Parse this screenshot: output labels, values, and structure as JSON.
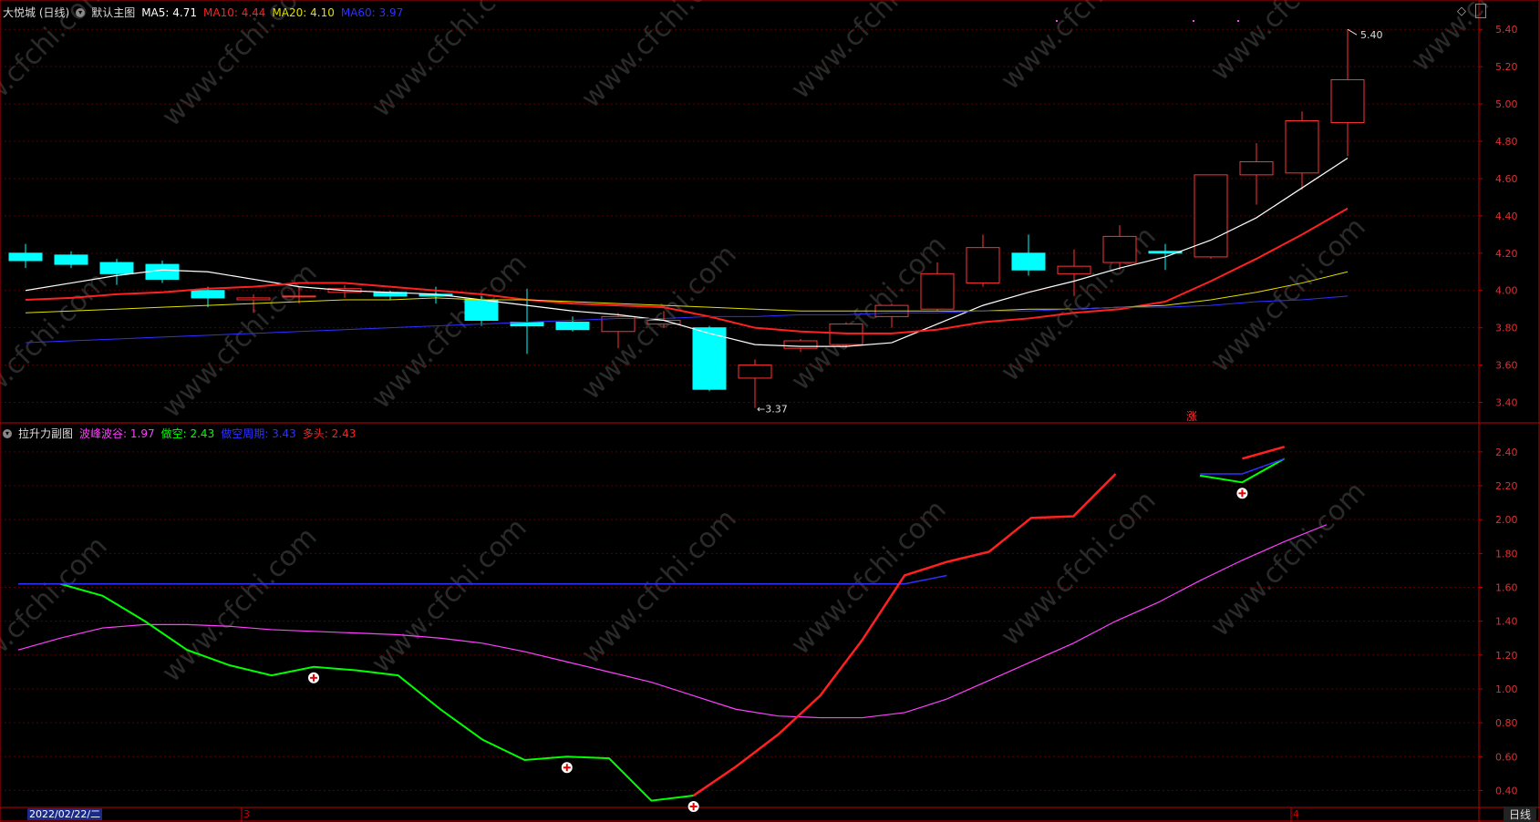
{
  "main_header": {
    "stock": "大悦城 (日线)",
    "template": "默认主图",
    "ma5_label": "MA5:",
    "ma5_val": "4.71",
    "ma10_label": "MA10:",
    "ma10_val": "4.44",
    "ma20_label": "MA20:",
    "ma20_val": "4.10",
    "ma60_label": "MA60:",
    "ma60_val": "3.97"
  },
  "sub_header": {
    "name": "拉升力副图",
    "s1_label": "波峰波谷:",
    "s1_val": "1.97",
    "s2_label": "做空:",
    "s2_val": "2.43",
    "s3_label": "做空周期:",
    "s3_val": "3.43",
    "s4_label": "多头:",
    "s4_val": "2.43"
  },
  "annotations": {
    "high": "5.40",
    "low": "3.37",
    "rise_marker": "涨"
  },
  "bottom": {
    "date": "2022/02/22/二",
    "m3": "3",
    "m4": "4",
    "period": "日线"
  },
  "watermark": "www.cfchi.com",
  "colors": {
    "up": "#ff3333",
    "down": "#00ffff",
    "ma5": "#ffffff",
    "ma10": "#ff2020",
    "ma20": "#e0e000",
    "ma60": "#3030ff",
    "grid": "#5a0000",
    "axis": "#c00000",
    "green": "#00ff00",
    "magenta": "#ff40ff"
  },
  "chart_data": [
    {
      "type": "candlestick",
      "title": "大悦城 (日线)",
      "ylim": [
        3.3,
        5.45
      ],
      "yticks": [
        "3.40",
        "3.60",
        "3.80",
        "4.00",
        "4.20",
        "4.40",
        "4.60",
        "4.80",
        "5.00",
        "5.20",
        "5.40"
      ],
      "candles": [
        [
          4.2,
          4.16,
          4.25,
          4.12
        ],
        [
          4.19,
          4.14,
          4.21,
          4.12
        ],
        [
          4.15,
          4.09,
          4.17,
          4.03
        ],
        [
          4.14,
          4.06,
          4.16,
          4.04
        ],
        [
          4.0,
          3.96,
          4.02,
          3.91
        ],
        [
          3.95,
          3.96,
          3.98,
          3.88
        ],
        [
          3.97,
          3.97,
          4.02,
          3.93
        ],
        [
          3.99,
          4.01,
          4.03,
          3.96
        ],
        [
          3.99,
          3.97,
          4.0,
          3.95
        ],
        [
          3.98,
          3.97,
          4.02,
          3.93
        ],
        [
          3.95,
          3.84,
          3.97,
          3.81
        ],
        [
          3.83,
          3.81,
          4.01,
          3.66
        ],
        [
          3.83,
          3.79,
          3.86,
          3.78
        ],
        [
          3.78,
          3.86,
          3.88,
          3.69
        ],
        [
          3.82,
          3.84,
          3.89,
          3.8
        ],
        [
          3.8,
          3.47,
          3.81,
          3.46
        ],
        [
          3.53,
          3.6,
          3.63,
          3.37
        ],
        [
          3.69,
          3.73,
          3.74,
          3.67
        ],
        [
          3.71,
          3.82,
          3.83,
          3.69
        ],
        [
          3.86,
          3.92,
          3.93,
          3.8
        ],
        [
          3.9,
          4.09,
          4.15,
          3.89
        ],
        [
          4.04,
          4.23,
          4.3,
          4.02
        ],
        [
          4.2,
          4.11,
          4.3,
          4.08
        ],
        [
          4.09,
          4.13,
          4.22,
          3.97
        ],
        [
          4.15,
          4.29,
          4.35,
          4.11
        ],
        [
          4.21,
          4.2,
          4.25,
          4.11
        ],
        [
          4.18,
          4.62,
          4.62,
          4.17
        ],
        [
          4.62,
          4.69,
          4.79,
          4.46
        ],
        [
          4.63,
          4.91,
          4.96,
          4.54
        ],
        [
          4.9,
          5.13,
          5.4,
          4.72
        ]
      ],
      "series": [
        {
          "name": "MA5",
          "values": [
            4.0,
            4.04,
            4.08,
            4.11,
            4.1,
            4.06,
            4.02,
            4.0,
            3.99,
            3.98,
            3.95,
            3.92,
            3.89,
            3.87,
            3.84,
            3.77,
            3.71,
            3.7,
            3.7,
            3.72,
            3.82,
            3.92,
            3.99,
            4.05,
            4.12,
            4.18,
            4.27,
            4.39,
            4.55,
            4.71
          ]
        },
        {
          "name": "MA10",
          "values": [
            3.95,
            3.96,
            3.98,
            3.99,
            4.01,
            4.02,
            4.04,
            4.04,
            4.02,
            4.0,
            3.98,
            3.95,
            3.93,
            3.92,
            3.91,
            3.86,
            3.8,
            3.78,
            3.77,
            3.77,
            3.79,
            3.83,
            3.85,
            3.88,
            3.9,
            3.94,
            4.05,
            4.17,
            4.3,
            4.44
          ]
        },
        {
          "name": "MA20",
          "values": [
            3.88,
            3.89,
            3.9,
            3.91,
            3.92,
            3.93,
            3.94,
            3.95,
            3.95,
            3.96,
            3.95,
            3.95,
            3.94,
            3.93,
            3.92,
            3.91,
            3.9,
            3.89,
            3.89,
            3.89,
            3.89,
            3.89,
            3.9,
            3.9,
            3.91,
            3.92,
            3.95,
            3.99,
            4.04,
            4.1
          ]
        },
        {
          "name": "MA60",
          "values": [
            3.72,
            3.73,
            3.74,
            3.75,
            3.76,
            3.77,
            3.78,
            3.79,
            3.8,
            3.81,
            3.82,
            3.83,
            3.84,
            3.85,
            3.85,
            3.86,
            3.86,
            3.87,
            3.87,
            3.88,
            3.88,
            3.89,
            3.89,
            3.9,
            3.91,
            3.91,
            3.92,
            3.94,
            3.95,
            3.97
          ]
        }
      ]
    },
    {
      "type": "line",
      "title": "拉升力副图",
      "ylim": [
        0.3,
        2.55
      ],
      "yticks": [
        "0.40",
        "0.60",
        "0.80",
        "1.00",
        "1.20",
        "1.40",
        "1.60",
        "1.80",
        "2.00",
        "2.20",
        "2.40"
      ],
      "series": [
        {
          "name": "波峰波谷",
          "values": [
            1.23,
            1.3,
            1.36,
            1.38,
            1.38,
            1.37,
            1.35,
            1.34,
            1.33,
            1.32,
            1.3,
            1.27,
            1.22,
            1.16,
            1.1,
            1.04,
            0.96,
            0.88,
            0.84,
            0.83,
            0.83,
            0.86,
            0.94,
            1.05,
            1.16,
            1.27,
            1.4,
            1.51,
            1.64,
            1.76,
            1.87,
            1.97
          ]
        },
        {
          "name": "做空",
          "values": [
            null,
            1.62,
            1.55,
            1.4,
            1.23,
            1.14,
            1.08,
            1.13,
            1.11,
            1.08,
            0.88,
            0.7,
            0.58,
            0.6,
            0.59,
            0.34,
            0.37,
            null,
            null,
            null,
            null,
            null,
            null,
            null,
            null,
            null,
            null,
            null,
            2.26,
            2.22,
            2.36,
            null
          ]
        },
        {
          "name": "做空周期",
          "values": [
            1.62,
            1.62,
            1.62,
            1.62,
            1.62,
            1.62,
            1.62,
            1.62,
            1.62,
            1.62,
            1.62,
            1.62,
            1.62,
            1.62,
            1.62,
            1.62,
            1.62,
            1.62,
            1.62,
            1.62,
            1.62,
            1.62,
            1.67,
            null,
            null,
            null,
            null,
            null,
            2.27,
            2.27,
            2.36,
            null
          ]
        },
        {
          "name": "多头",
          "values": [
            null,
            null,
            null,
            null,
            null,
            null,
            null,
            null,
            null,
            null,
            null,
            null,
            null,
            null,
            null,
            null,
            0.37,
            0.54,
            0.73,
            0.96,
            1.29,
            1.67,
            1.75,
            1.81,
            2.01,
            2.02,
            2.27,
            null,
            null,
            2.36,
            2.43,
            null
          ]
        }
      ],
      "markers": [
        7,
        13,
        16,
        29
      ]
    }
  ]
}
